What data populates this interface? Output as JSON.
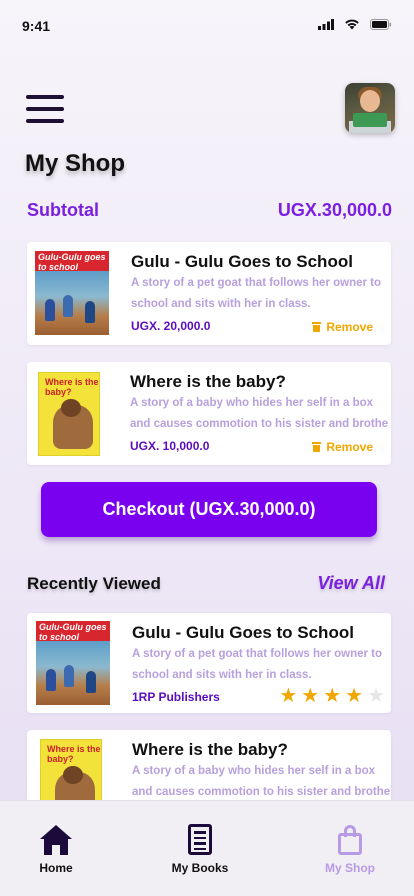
{
  "status_bar": {
    "time": "9:41"
  },
  "header": {
    "title": "My Shop"
  },
  "subtotal": {
    "label": "Subtotal",
    "value": "UGX.30,000.0"
  },
  "cart": [
    {
      "title": "Gulu - Gulu Goes to School",
      "desc_line1": "A story of a pet goat that follows her owner to",
      "desc_line2": "school and sits with her in class.",
      "price": "UGX. 20,000.0",
      "remove_label": "Remove",
      "cover_text": "Gulu-Gulu goes to school"
    },
    {
      "title": "Where is the baby?",
      "desc_line1": "A story of a baby who hides her self in a box",
      "desc_line2": "and causes commotion to his sister and brothe",
      "price": "UGX. 10,000.0",
      "remove_label": "Remove",
      "cover_text": "Where is the baby?"
    }
  ],
  "checkout": {
    "label": "Checkout (UGX.30,000.0)"
  },
  "recent": {
    "title": "Recently Viewed",
    "view_all": "View All",
    "items": [
      {
        "title": "Gulu - Gulu Goes to School",
        "desc_line1": "A story of a pet goat that follows her owner to",
        "desc_line2": "school and sits with her in class.",
        "publisher": "1RP Publishers",
        "rating": 4,
        "rating_max": 5,
        "cover_text": "Gulu-Gulu goes to school"
      },
      {
        "title": "Where is the baby?",
        "desc_line1": "A story of a baby who hides her self in a box",
        "desc_line2": "and causes commotion to his sister and brothe",
        "cover_text": "Where is the baby?"
      }
    ]
  },
  "nav": {
    "home": "Home",
    "books": "My Books",
    "shop": "My Shop"
  },
  "colors": {
    "accent": "#7a00f0",
    "price": "#5a0dbd",
    "remove": "#f2a600",
    "desc": "#b7a0dd",
    "nav_inactive": "#b79be6"
  }
}
